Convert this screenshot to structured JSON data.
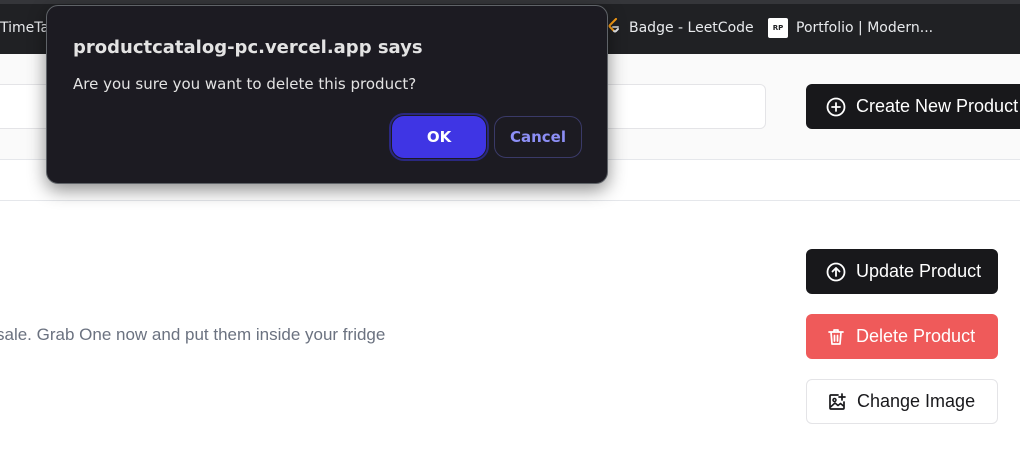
{
  "bookmarks": {
    "items": [
      {
        "label": "TimeTab"
      },
      {
        "label": "Badge - LeetCode"
      },
      {
        "label": "Portfolio | Modern..."
      }
    ],
    "portfolio_icon_text": "RP"
  },
  "dialog": {
    "title": "productcatalog-pc.vercel.app says",
    "message": "Are you sure you want to delete this product?",
    "ok_label": "OK",
    "cancel_label": "Cancel"
  },
  "page": {
    "search": {
      "value": "",
      "placeholder": ""
    },
    "create_button_label": "Create New Product",
    "actions": {
      "update_label": "Update Product",
      "delete_label": "Delete Product",
      "change_image_label": "Change Image"
    },
    "product": {
      "description_partial": "sale. Grab One now and put them inside your fridge"
    }
  },
  "colors": {
    "browser_bar": "#202124",
    "dialog_bg": "#1c1b22",
    "ok_button": "#3f35e4",
    "cancel_text": "#8d8ff6",
    "dark_button": "#18181b",
    "delete_button": "#ef5a5a"
  },
  "icons": {
    "create": "plus-circle-icon",
    "update": "arrow-up-circle-icon",
    "delete": "trash-icon",
    "change_image": "image-plus-icon",
    "leetcode": "leetcode-icon",
    "portfolio": "portfolio-favicon-icon"
  }
}
